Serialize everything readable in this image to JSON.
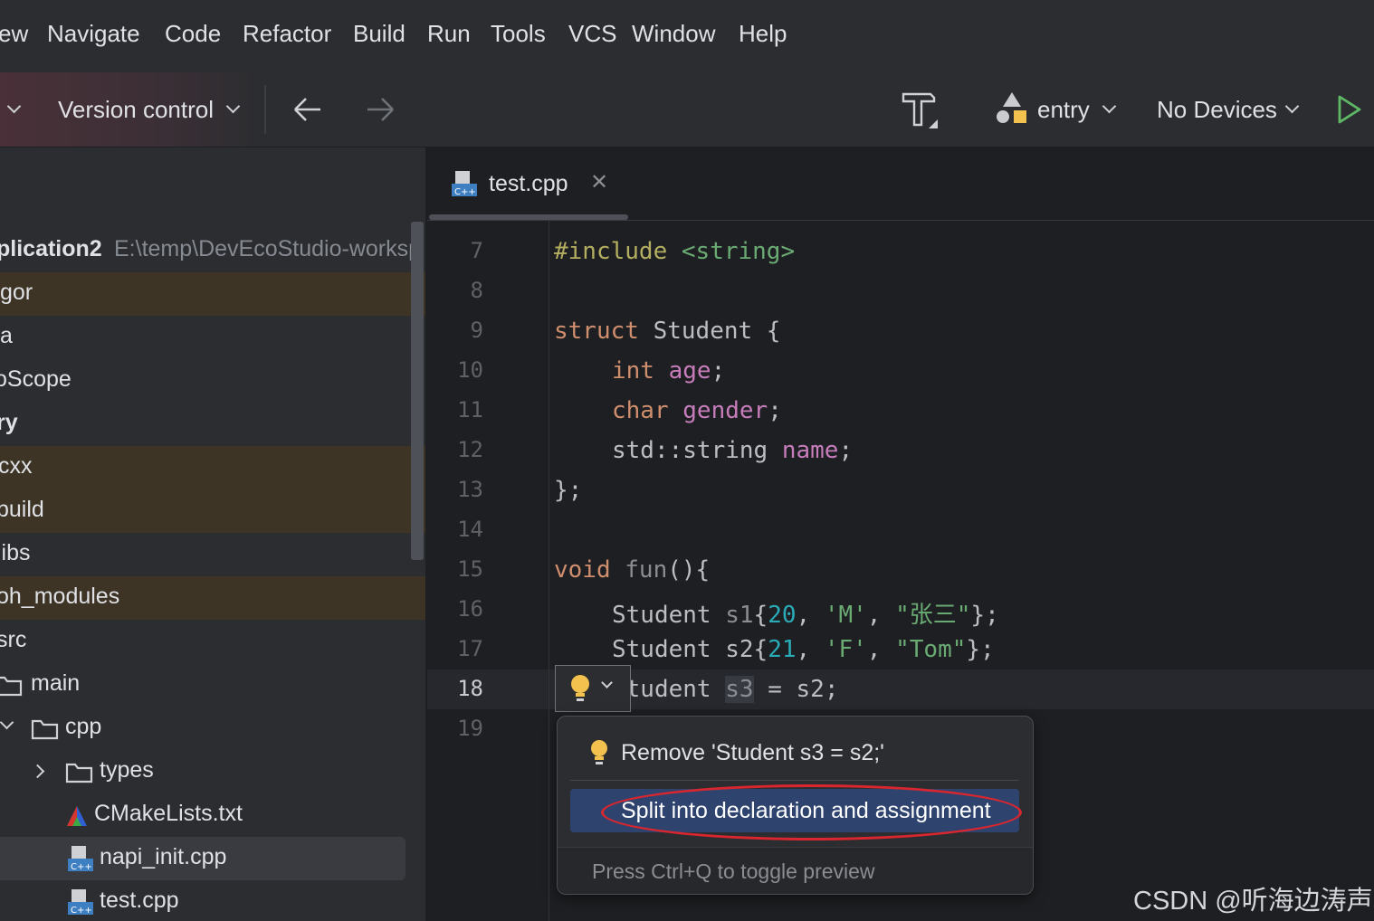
{
  "menubar": {
    "items": [
      "ew",
      "Navigate",
      "Code",
      "Refactor",
      "Build",
      "Run",
      "Tools",
      "VCS",
      "Window",
      "Help"
    ]
  },
  "toolbar": {
    "vcs_label": "Version control",
    "run_config": "entry",
    "device": "No Devices",
    "icons": [
      "back-arrow-icon",
      "forward-arrow-icon",
      "build-hammer-icon",
      "run-play-icon"
    ]
  },
  "project": {
    "root_name": "plication2",
    "root_path": "E:\\temp\\DevEcoStudio-worksp",
    "items": [
      {
        "label": "gor"
      },
      {
        "label": "a"
      },
      {
        "label": "oScope"
      },
      {
        "label": "ry"
      },
      {
        "label": "cxx"
      },
      {
        "label": "build"
      },
      {
        "label": "libs"
      },
      {
        "label": "oh_modules"
      },
      {
        "label": "src"
      },
      {
        "label": "main"
      },
      {
        "label": "cpp"
      },
      {
        "label": "types"
      },
      {
        "label": "CMakeLists.txt"
      },
      {
        "label": "napi_init.cpp"
      },
      {
        "label": "test.cpp"
      }
    ]
  },
  "editor": {
    "tab": "test.cpp",
    "line_numbers": [
      "7",
      "8",
      "9",
      "10",
      "11",
      "12",
      "13",
      "14",
      "15",
      "16",
      "17",
      "18",
      "19"
    ],
    "current_line": "18",
    "code": {
      "l7": {
        "a": "#include",
        "b": " <string>"
      },
      "l9": {
        "a": "struct",
        "b": " Student {"
      },
      "l10": {
        "a": "int",
        "b": " ",
        "c": "age",
        "d": ";"
      },
      "l11": {
        "a": "char",
        "b": " ",
        "c": "gender",
        "d": ";"
      },
      "l12": {
        "a": "std::string ",
        "c": "name",
        "d": ";"
      },
      "l13": {
        "a": "};"
      },
      "l15": {
        "a": "void",
        "b": " ",
        "c": "fun",
        "d": "(){"
      },
      "l16": {
        "a": "Student ",
        "b": "s1",
        "c": "{",
        "n": "20",
        "s1": ", ",
        "q1": "'M'",
        "s2": ", ",
        "q2": "\"张三\"",
        "e": "};"
      },
      "l17": {
        "a": "Student ",
        "b": "s2",
        "c": "{",
        "n": "21",
        "s1": ", ",
        "q1": "'F'",
        "s2": ", ",
        "q2": "\"Tom\"",
        "e": "};"
      },
      "l18": {
        "a": "Student ",
        "b": "s3",
        "c": " = s2;"
      }
    }
  },
  "intention_popup": {
    "item1": "Remove 'Student s3 = s2;'",
    "item2": "Split into declaration and assignment",
    "footer": "Press Ctrl+Q to toggle preview"
  },
  "watermark": "CSDN @听海边涛声",
  "colors": {
    "selection": "#2e436e",
    "annotation_ring": "#d9262f",
    "keyword": "#cf8e6d",
    "field": "#c77dbb",
    "number": "#2aacb8",
    "string": "#6aab73"
  }
}
